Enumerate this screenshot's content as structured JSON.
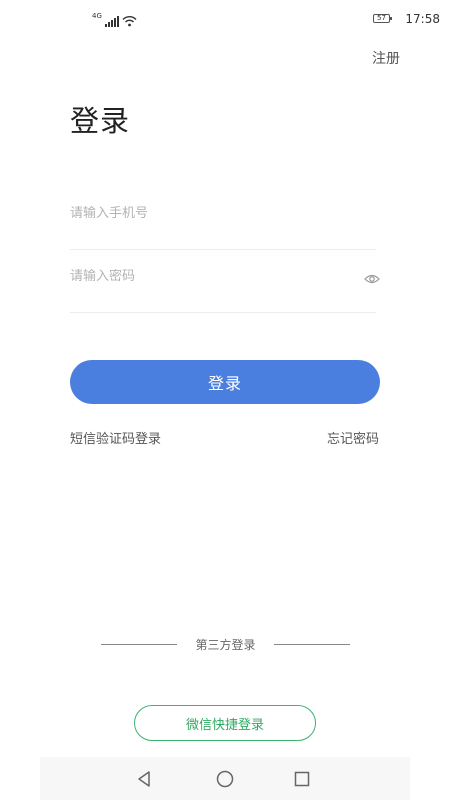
{
  "status_bar": {
    "network_type": "4G",
    "battery_level": "57",
    "time": "17:58",
    "icons": [
      "signal-icon",
      "wifi-icon",
      "battery-icon"
    ]
  },
  "header": {
    "register_label": "注册"
  },
  "page": {
    "title": "登录"
  },
  "form": {
    "phone_placeholder": "请输入手机号",
    "phone_value": "",
    "password_placeholder": "请输入密码",
    "password_value": "",
    "password_toggle_icon": "eye-icon"
  },
  "actions": {
    "login_label": "登录",
    "sms_login_label": "短信验证码登录",
    "forgot_password_label": "忘记密码"
  },
  "third_party": {
    "label": "第三方登录",
    "wechat_label": "微信快捷登录"
  },
  "nav_bar": {
    "icons": [
      "back-icon",
      "home-icon",
      "recent-apps-icon"
    ]
  },
  "colors": {
    "primary": "#4a7fe0",
    "wechat_green": "#2eaa60",
    "placeholder": "#b3b3b3",
    "divider": "#ececec"
  }
}
